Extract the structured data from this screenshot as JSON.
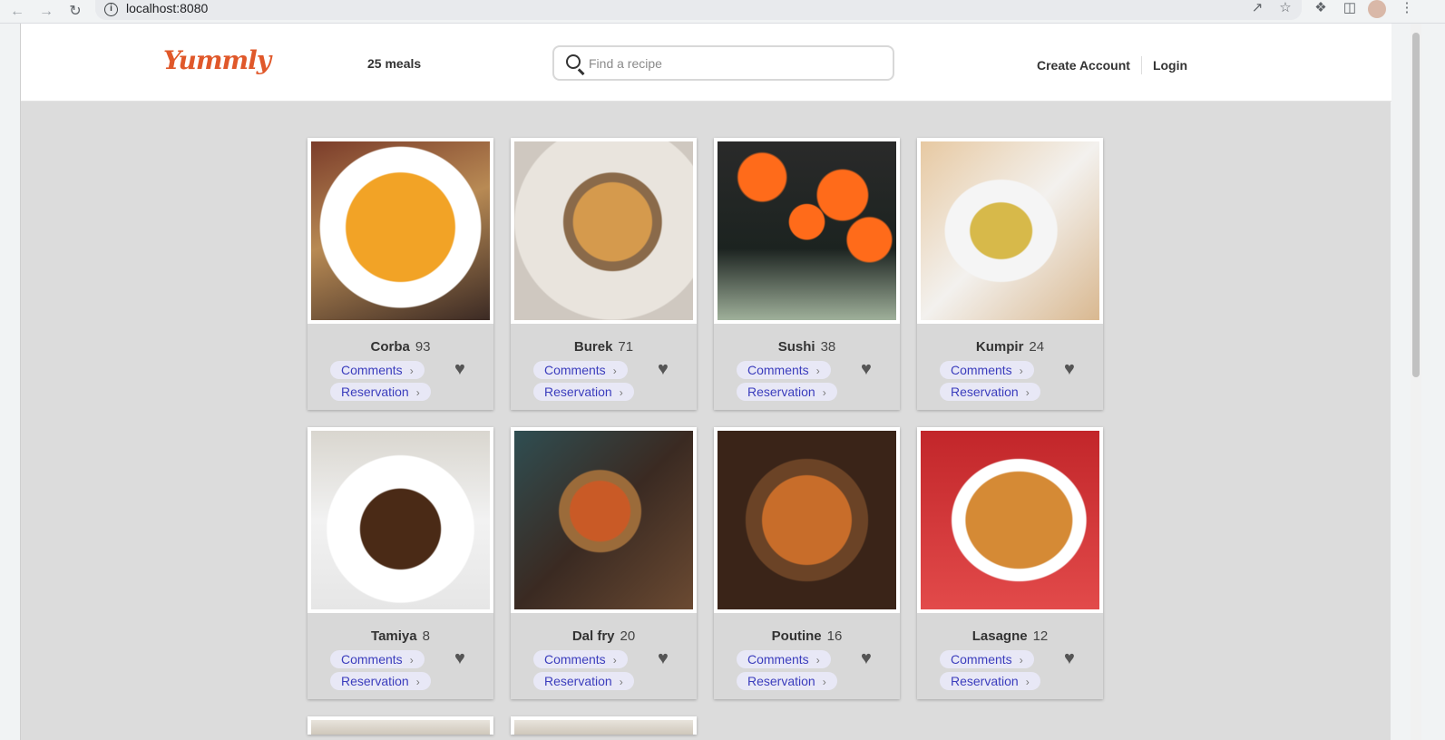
{
  "browser": {
    "url": "localhost:8080",
    "icons": [
      "back-icon",
      "forward-icon",
      "reload-icon",
      "info-icon",
      "share-icon",
      "star-icon",
      "extensions-icon",
      "sidebar-icon",
      "profile-avatar",
      "menu-icon"
    ]
  },
  "header": {
    "logo_text": "Yummly",
    "meal_count": "25 meals",
    "search_placeholder": "Find a recipe",
    "create_account": "Create Account",
    "login": "Login"
  },
  "colors": {
    "brand": "#e0582a",
    "pill_bg": "#e8e8f6",
    "pill_text": "#3b3dbd",
    "page_bg": "#dcdcdc"
  },
  "meals": [
    {
      "name": "Corba",
      "likes": "93",
      "comments": "Comments",
      "reservation": "Reservation"
    },
    {
      "name": "Burek",
      "likes": "71",
      "comments": "Comments",
      "reservation": "Reservation"
    },
    {
      "name": "Sushi",
      "likes": "38",
      "comments": "Comments",
      "reservation": "Reservation"
    },
    {
      "name": "Kumpir",
      "likes": "24",
      "comments": "Comments",
      "reservation": "Reservation"
    },
    {
      "name": "Tamiya",
      "likes": "8",
      "comments": "Comments",
      "reservation": "Reservation"
    },
    {
      "name": "Dal fry",
      "likes": "20",
      "comments": "Comments",
      "reservation": "Reservation"
    },
    {
      "name": "Poutine",
      "likes": "16",
      "comments": "Comments",
      "reservation": "Reservation"
    },
    {
      "name": "Lasagne",
      "likes": "12",
      "comments": "Comments",
      "reservation": "Reservation"
    }
  ]
}
